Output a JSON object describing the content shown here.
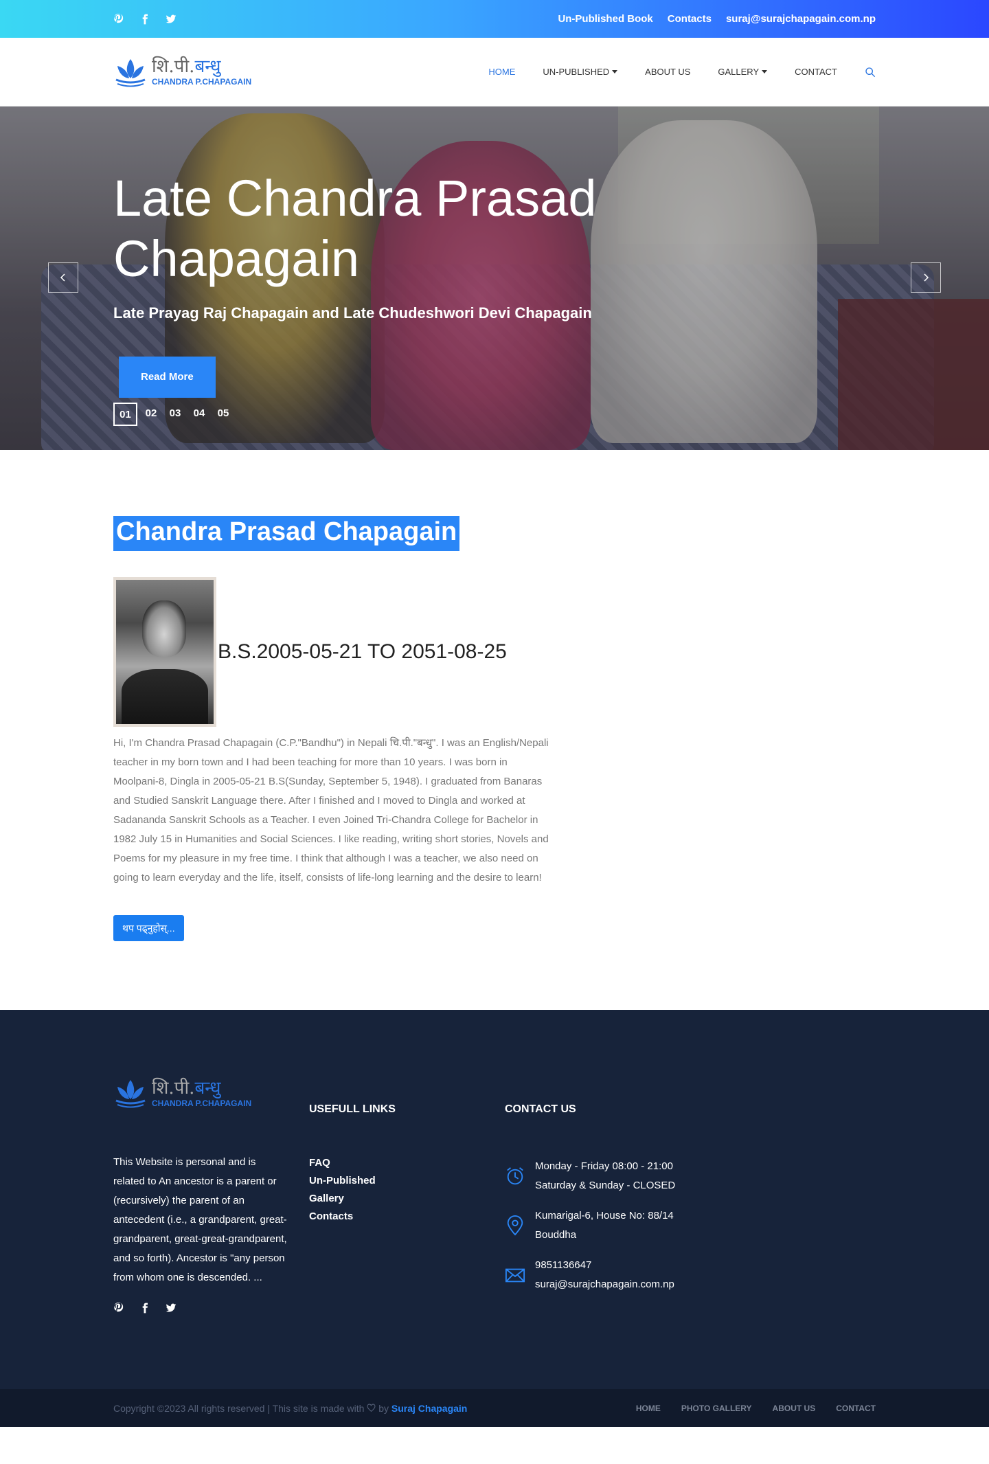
{
  "topbar": {
    "social": [
      "pinterest-icon",
      "facebook-icon",
      "twitter-icon"
    ],
    "links": [
      "Un-Published Book",
      "Contacts",
      "suraj@surajchapagain.com.np"
    ]
  },
  "logo": {
    "devanagari": "शि.पी.",
    "devanagari_accent": "बन्धु",
    "latin": "CHANDRA P.CHAPAGAIN"
  },
  "nav": {
    "items": [
      {
        "label": "HOME",
        "active": true
      },
      {
        "label": "UN-PUBLISHED",
        "dropdown": true
      },
      {
        "label": "ABOUT US"
      },
      {
        "label": "GALLERY",
        "dropdown": true
      },
      {
        "label": "CONTACT"
      }
    ]
  },
  "hero": {
    "title": "Late Chandra Prasad Chapagain",
    "subtitle": "Late Prayag Raj Chapagain and Late Chudeshwori Devi Chapagain",
    "button": "Read More",
    "pages": [
      "01",
      "02",
      "03",
      "04",
      "05"
    ],
    "active_page": 0
  },
  "bio": {
    "name": "Chandra Prasad Chapagain",
    "dates": "B.S.2005-05-21 TO 2051-08-25",
    "text": "Hi, I'm Chandra Prasad Chapagain (C.P.\"Bandhu\") in Nepali चि.पी.\"बन्धु\". I was an English/Nepali teacher in my born town and I had been teaching for more than 10 years. I was born in Moolpani-8, Dingla in 2005-05-21 B.S(Sunday, September 5, 1948). I graduated from Banaras and Studied Sanskrit Language there. After I finished and I moved to Dingla and worked at Sadananda Sanskrit Schools as a Teacher. I even Joined Tri-Chandra College for Bachelor in 1982 July 15 in Humanities and Social Sciences. I like reading, writing short stories, Novels and Poems for my pleasure in my free time. I think that although I was a teacher, we also need on going to learn everyday and the life, itself, consists of life-long learning and the desire to learn!",
    "button": "थप पढ्नुहोस्..."
  },
  "footer": {
    "description": "This Website is personal and is related to An ancestor is a parent or (recursively) the parent of an antecedent (i.e., a grandparent, great-grandparent, great-great-grandparent, and so forth). Ancestor is \"any person from whom one is descended. ...",
    "links_heading": "USEFULL LINKS",
    "links": [
      "FAQ",
      "Un-Published",
      "Gallery",
      "Contacts"
    ],
    "contact_heading": "CONTACT US",
    "hours": [
      "Monday - Friday 08:00 - 21:00",
      "Saturday & Sunday - CLOSED"
    ],
    "address": [
      "Kumarigal-6, House No: 88/14",
      "Bouddha"
    ],
    "phone": "9851136647",
    "email": "suraj@surajchapagain.com.np"
  },
  "bottom": {
    "copyright": "Copyright ©2023 All rights reserved | This site is made with",
    "by": "by",
    "author": "Suraj Chapagain",
    "nav": [
      "HOME",
      "PHOTO GALLERY",
      "ABOUT US",
      "CONTACT"
    ]
  },
  "colors": {
    "accent": "#2a86f7",
    "footer_bg": "#17233a",
    "bottom_bg": "#111a2c"
  }
}
